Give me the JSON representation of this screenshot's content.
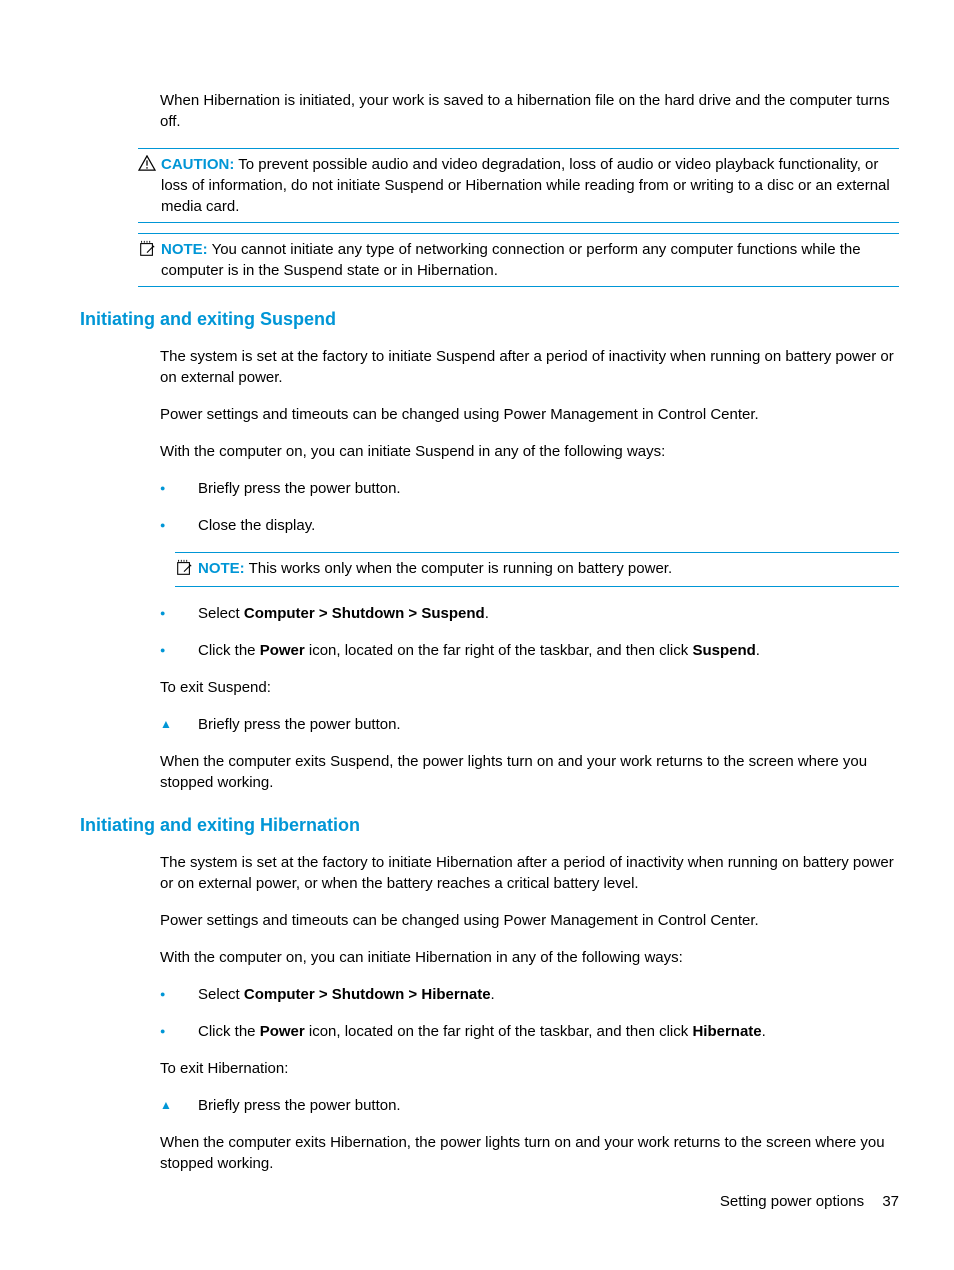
{
  "intro": "When Hibernation is initiated, your work is saved to a hibernation file on the hard drive and the computer turns off.",
  "caution": {
    "label": "CAUTION:",
    "text": "To prevent possible audio and video degradation, loss of audio or video playback functionality, or loss of information, do not initiate Suspend or Hibernation while reading from or writing to a disc or an external media card."
  },
  "note1": {
    "label": "NOTE:",
    "text": "You cannot initiate any type of networking connection or perform any computer functions while the computer is in the Suspend state or in Hibernation."
  },
  "suspend": {
    "heading": "Initiating and exiting Suspend",
    "p1": "The system is set at the factory to initiate Suspend after a period of inactivity when running on battery power or on external power.",
    "p2": "Power settings and timeouts can be changed using Power Management in Control Center.",
    "p3": "With the computer on, you can initiate Suspend in any of the following ways:",
    "b1": "Briefly press the power button.",
    "b2": "Close the display.",
    "note": {
      "label": "NOTE:",
      "text": "This works only when the computer is running on battery power."
    },
    "b3_pre": "Select ",
    "b3_bold": "Computer > Shutdown > Suspend",
    "b3_post": ".",
    "b4_pre": "Click the ",
    "b4_bold1": "Power",
    "b4_mid": " icon, located on the far right of the taskbar, and then click ",
    "b4_bold2": "Suspend",
    "b4_post": ".",
    "exit_label": "To exit Suspend:",
    "exit_b1": "Briefly press the power button.",
    "exit_p": "When the computer exits Suspend, the power lights turn on and your work returns to the screen where you stopped working."
  },
  "hibernate": {
    "heading": "Initiating and exiting Hibernation",
    "p1": "The system is set at the factory to initiate Hibernation after a period of inactivity when running on battery power or on external power, or when the battery reaches a critical battery level.",
    "p2": "Power settings and timeouts can be changed using Power Management in Control Center.",
    "p3": "With the computer on, you can initiate Hibernation in any of the following ways:",
    "b1_pre": "Select ",
    "b1_bold": "Computer > Shutdown > Hibernate",
    "b1_post": ".",
    "b2_pre": "Click the ",
    "b2_bold1": "Power",
    "b2_mid": " icon, located on the far right of the taskbar, and then click ",
    "b2_bold2": "Hibernate",
    "b2_post": ".",
    "exit_label": "To exit Hibernation:",
    "exit_b1": "Briefly press the power button.",
    "exit_p": "When the computer exits Hibernation, the power lights turn on and your work returns to the screen where you stopped working."
  },
  "footer": {
    "text": "Setting power options",
    "page": "37"
  }
}
